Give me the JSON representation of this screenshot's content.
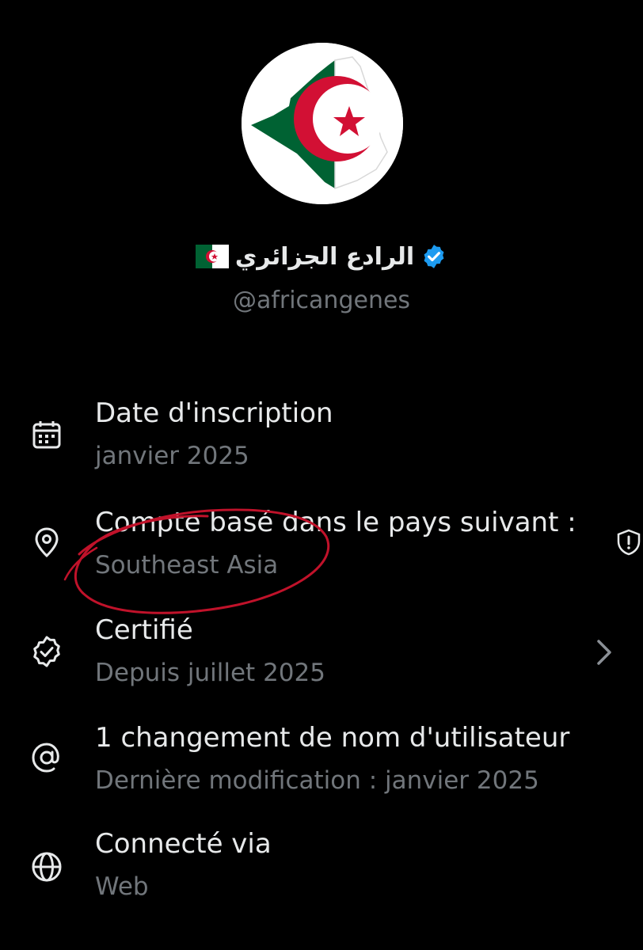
{
  "profile": {
    "display_name": "الرادع الجزائري",
    "handle": "@africangenes",
    "verified": true,
    "avatar": "algeria-map-flag"
  },
  "colors": {
    "background": "#000000",
    "primary_text": "#e7e9ea",
    "secondary_text": "#71767b",
    "verified_blue": "#1d9bf0",
    "annotation_red": "#c0122a",
    "flag_green": "#006233",
    "flag_red": "#d21034"
  },
  "info_rows": [
    {
      "icon": "calendar-icon",
      "title": "Date d'inscription",
      "subtitle": "janvier 2025"
    },
    {
      "icon": "location-pin-icon",
      "title": "Compte basé dans le pays suivant :",
      "subtitle": "Southeast Asia",
      "trailing_icon": "shield-alert-icon"
    },
    {
      "icon": "verified-seal-icon",
      "title": "Certifié",
      "subtitle": "Depuis juillet 2025",
      "trailing_icon": "chevron-right-icon"
    },
    {
      "icon": "at-sign-icon",
      "title": "1 changement de nom d'utilisateur",
      "subtitle": "Dernière modification : janvier 2025"
    },
    {
      "icon": "globe-icon",
      "title": "Connecté via",
      "subtitle": "Web"
    }
  ]
}
